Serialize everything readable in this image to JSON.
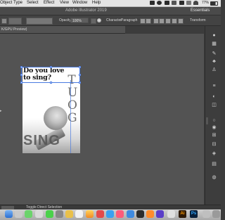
{
  "menubar": {
    "items": [
      "Object",
      "Type",
      "Select",
      "Effect",
      "View",
      "Window",
      "Help"
    ],
    "battery": "77%"
  },
  "titlebar": {
    "title": "Adobe Illustrator 2019",
    "workspace": "Essentials Classic"
  },
  "controlbar": {
    "opacity_label": "Opacity:",
    "opacity_value": "100%",
    "character_label": "Character",
    "paragraph_label": "Paragraph",
    "transform_label": "Transform"
  },
  "document": {
    "tab_label": "K/GPU Preview)"
  },
  "artboard": {
    "headline": "Do you love to sing?",
    "vertical_text": "TUOG",
    "bottom_text": "SING"
  },
  "statusbar": {
    "tool_label": "Toggle Direct Selection"
  },
  "dock": {
    "apps": [
      {
        "name": "Ai",
        "bg": "#2e1a05",
        "fg": "#ff9a00"
      },
      {
        "name": "Ps",
        "bg": "#061e3a",
        "fg": "#31a8ff"
      }
    ]
  },
  "colors": {
    "selection": "#4a7be0",
    "panel_bg": "#3c3c3c",
    "canvas_bg": "#535353"
  }
}
